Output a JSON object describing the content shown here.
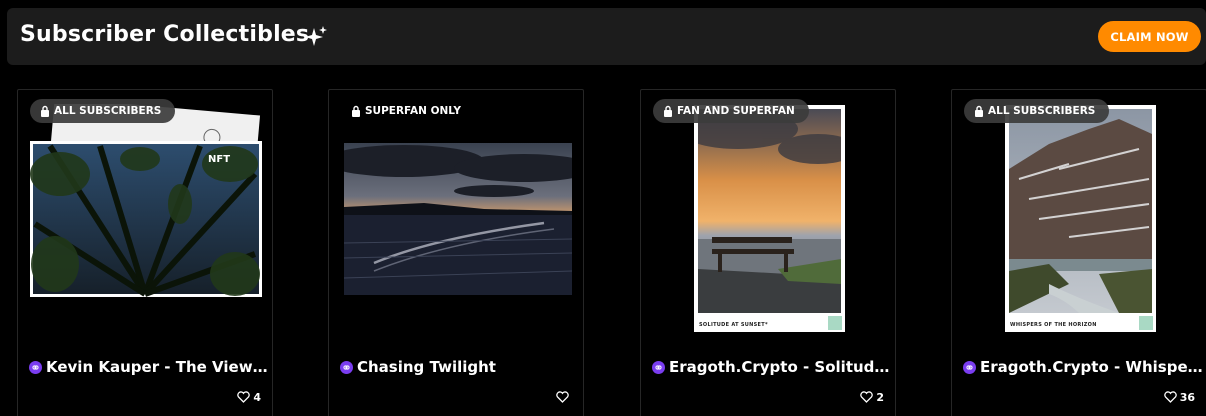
{
  "header": {
    "title": "Subscriber Collectibles",
    "claim_label": "CLAIM NOW",
    "accent_color": "#ff8a00"
  },
  "cards": [
    {
      "badge": "ALL SUBSCRIBERS",
      "tag": "NFT",
      "title": "Kevin Kauper - The View A...",
      "likes": "4",
      "image": "forest canopy looking up at night sky"
    },
    {
      "badge": "SUPERFAN ONLY",
      "title": "Chasing Twilight",
      "likes": "",
      "image": "dark sea with boat wake under sunset clouds"
    },
    {
      "badge": "FAN AND SUPERFAN",
      "caption": "SOLITUDE AT SUNSET*",
      "title": "Eragoth.Crypto - Solitude ...",
      "likes": "2",
      "image": "bench facing the sea at sunset"
    },
    {
      "badge": "ALL SUBSCRIBERS",
      "caption": "WHISPERS OF THE HORIZON",
      "title": "Eragoth.Crypto - Whisper...",
      "likes": "36",
      "image": "snowy mountain above a river valley"
    }
  ]
}
